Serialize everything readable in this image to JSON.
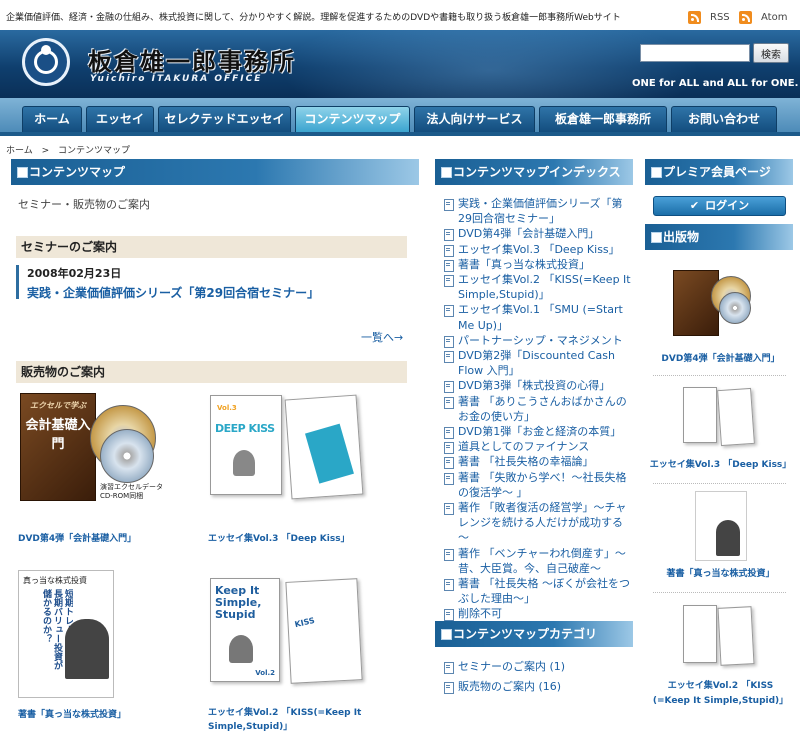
{
  "top": {
    "tagline": "企業価値評価、経済・金融の仕組み、株式投資に関して、分かりやすく解説。理解を促進するためのDVDや書籍も取り扱う板倉雄一郎事務所Webサイト",
    "rss": "RSS",
    "atom": "Atom"
  },
  "header": {
    "title": "板倉雄一郎事務所",
    "subtitle": "Yuichiro ITAKURA OFFICE",
    "search_placeholder": "",
    "search_button": "検索",
    "slogan": "ONE for ALL and ALL for ONE."
  },
  "nav": {
    "tabs": [
      {
        "label": "ホーム"
      },
      {
        "label": "エッセイ"
      },
      {
        "label": "セレクテッドエッセイ"
      },
      {
        "label": "コンテンツマップ"
      },
      {
        "label": "法人向けサービス"
      },
      {
        "label": "板倉雄一郎事務所"
      },
      {
        "label": "お問い合わせ"
      }
    ]
  },
  "breadcrumb": {
    "home": "ホーム",
    "sep": ">",
    "current": "コンテンツマップ"
  },
  "main": {
    "heading": "コンテンツマップ",
    "intro": "セミナー・販売物のご案内",
    "seminar_heading": "セミナーのご案内",
    "seminar": {
      "date": "2008年02月23日",
      "title": "実践・企業価値評価シリーズ「第29回合宿セミナー」"
    },
    "more": "一覧へ→",
    "sales_heading": "販売物のご案内",
    "products": [
      {
        "caption": "DVD第4弾「会計基礎入門」",
        "art_title": "会計基礎入門",
        "art_sub": "エクセルで学ぶ",
        "art_note": "演習エクセルデータ\nCD-ROM同梱"
      },
      {
        "caption": "エッセイ集Vol.3 「Deep Kiss」",
        "art_title": "DEEP KISS",
        "art_vol": "Vol.3"
      },
      {
        "caption": "著書「真っ当な株式投資」",
        "art_title": "真っ当な株式投資",
        "art_body": "短期トレードよりも長期バリュー投資が儲かるのか？"
      },
      {
        "caption": "エッセイ集Vol.2 「KISS(=Keep It Simple,Stupid)」",
        "art_title": "Keep It Simple, Stupid",
        "art_vol": "Vol.2"
      }
    ]
  },
  "index": {
    "heading": "コンテンツマップインデックス",
    "items": [
      "実践・企業価値評価シリーズ「第29回合宿セミナー」",
      "DVD第4弾「会計基礎入門」",
      "エッセイ集Vol.3 「Deep Kiss」",
      "著書「真っ当な株式投資」",
      "エッセイ集Vol.2 「KISS(=Keep It Simple,Stupid)」",
      "エッセイ集Vol.1 「SMU (=Start Me Up)」",
      "パートナーシップ・マネジメント",
      "DVD第2弾「Discounted Cash Flow 入門」",
      "DVD第3弾「株式投資の心得」",
      "著書 「ありこうさんおばかさんのお金の使い方」",
      "DVD第1弾「お金と経済の本質」",
      "道具としてのファイナンス",
      "著書 「社長失格の幸福論」",
      "著書 「失敗から学べ！～社長失格の復活学～ 」",
      "著作 「敗者復活の経営学」～チャレンジを続ける人だけが成功する～",
      "著作 「ベンチャーわれ倒産す」～昔、大臣賞。今、自己破産～",
      "著書 「社長失格 ～ぼくが会社をつぶした理由～」",
      "削除不可"
    ]
  },
  "categories": {
    "heading": "コンテンツマップカテゴリ",
    "items": [
      "セミナーのご案内 (1)",
      "販売物のご案内 (16)"
    ]
  },
  "sidebar": {
    "premium_heading": "プレミア会員ページ",
    "login": "ログイン",
    "publications_heading": "出版物",
    "publications": [
      "DVD第4弾「会計基礎入門」",
      "エッセイ集Vol.3 「Deep Kiss」",
      "著書「真っ当な株式投資」",
      "エッセイ集Vol.2 「KISS\n(=Keep It Simple,Stupid)」"
    ]
  },
  "colors": {
    "header_bg": "#0f3f6e",
    "nav_bg": "#4d8bb8",
    "active_tab": "#3ba4cf",
    "link": "#1a5fa3",
    "subhead_bg": "#efe7d8"
  }
}
